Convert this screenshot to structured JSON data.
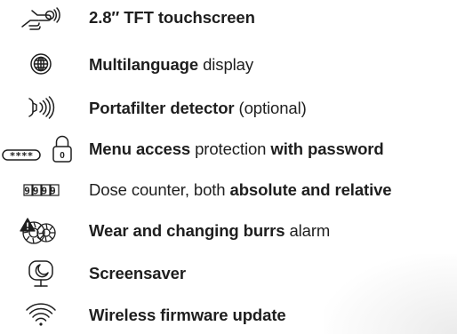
{
  "features": [
    {
      "icon": "touch-hand-icon",
      "parts": [
        {
          "text": "2.8″ TFT touchscreen",
          "bold": true
        }
      ]
    },
    {
      "icon": "globe-icon",
      "parts": [
        {
          "text": "Multilanguage",
          "bold": true
        },
        {
          "text": " display",
          "bold": false
        }
      ]
    },
    {
      "icon": "portafilter-signal-icon",
      "parts": [
        {
          "text": "Portafilter detector",
          "bold": true
        },
        {
          "text": " (optional)",
          "bold": false
        }
      ]
    },
    {
      "icon": "password-lock-icon",
      "parts": [
        {
          "text": "Menu access",
          "bold": true
        },
        {
          "text": " protection ",
          "bold": false
        },
        {
          "text": "with password",
          "bold": true
        }
      ]
    },
    {
      "icon": "counter-digits-icon",
      "parts": [
        {
          "text": "Dose counter, both ",
          "bold": false
        },
        {
          "text": "absolute and relative",
          "bold": true
        }
      ]
    },
    {
      "icon": "burr-warning-icon",
      "parts": [
        {
          "text": "Wear and changing burrs",
          "bold": true
        },
        {
          "text": " alarm",
          "bold": false
        }
      ]
    },
    {
      "icon": "screensaver-moon-icon",
      "parts": [
        {
          "text": "Screensaver",
          "bold": true
        }
      ]
    },
    {
      "icon": "wifi-icon",
      "parts": [
        {
          "text": "Wireless firmware update",
          "bold": true
        }
      ]
    }
  ],
  "icon_labels": {
    "password_mask": "****",
    "lock_digit": "0",
    "counter_digits": "9999"
  },
  "colors": {
    "text": "#1e1e1e",
    "icon_stroke": "#1e1e1e",
    "background": "#ffffff"
  }
}
